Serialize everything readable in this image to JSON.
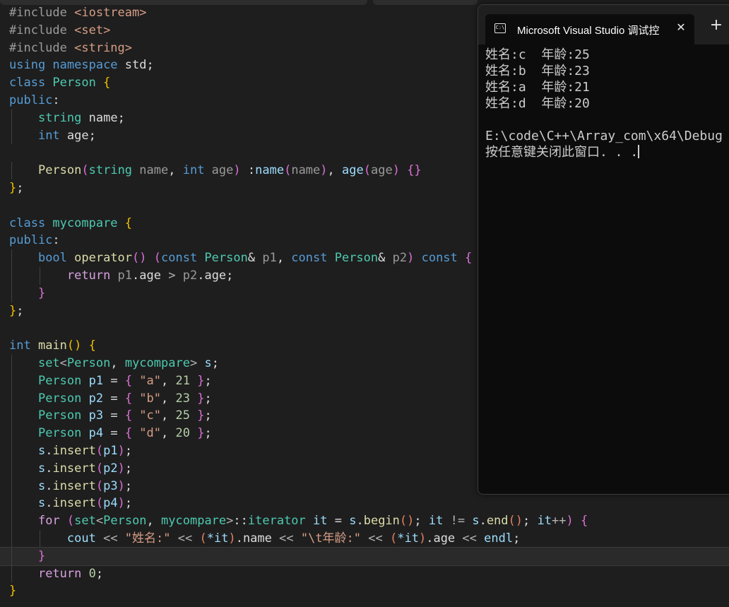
{
  "editor": {
    "lines": [
      [
        [
          "#include ",
          "pp"
        ],
        [
          "<iostream>",
          "inc"
        ]
      ],
      [
        [
          "#include ",
          "pp"
        ],
        [
          "<set>",
          "inc"
        ]
      ],
      [
        [
          "#include ",
          "pp"
        ],
        [
          "<string>",
          "inc"
        ]
      ],
      [
        [
          "using ",
          "kw"
        ],
        [
          "namespace ",
          "kw"
        ],
        [
          "std",
          ""
        ],
        [
          ";",
          ""
        ]
      ],
      [
        [
          "class ",
          "kw"
        ],
        [
          "Person ",
          "cls"
        ],
        [
          "{",
          "b1"
        ]
      ],
      [
        [
          "public",
          "kw"
        ],
        [
          ":",
          ""
        ]
      ],
      [
        [
          "    ",
          ""
        ],
        [
          "string ",
          "cls"
        ],
        [
          "name",
          ""
        ],
        [
          ";",
          ""
        ]
      ],
      [
        [
          "    ",
          ""
        ],
        [
          "int ",
          "kw"
        ],
        [
          "age",
          ""
        ],
        [
          ";",
          ""
        ]
      ],
      [],
      [
        [
          "    ",
          ""
        ],
        [
          "Person",
          "fn"
        ],
        [
          "(",
          "b2"
        ],
        [
          "string ",
          "cls"
        ],
        [
          "name",
          "param"
        ],
        [
          ", ",
          ""
        ],
        [
          "int ",
          "kw"
        ],
        [
          "age",
          "param"
        ],
        [
          ") ",
          "b2"
        ],
        [
          ":",
          ""
        ],
        [
          "name",
          "var"
        ],
        [
          "(",
          "b2"
        ],
        [
          "name",
          "param"
        ],
        [
          ")",
          "b2"
        ],
        [
          ", ",
          ""
        ],
        [
          "age",
          "var"
        ],
        [
          "(",
          "b2"
        ],
        [
          "age",
          "param"
        ],
        [
          ") ",
          "b2"
        ],
        [
          "{}",
          "b2"
        ]
      ],
      [
        [
          "}",
          "b1"
        ],
        [
          ";",
          ""
        ]
      ],
      [],
      [
        [
          "class ",
          "kw"
        ],
        [
          "mycompare ",
          "cls"
        ],
        [
          "{",
          "b1"
        ]
      ],
      [
        [
          "public",
          "kw"
        ],
        [
          ":",
          ""
        ]
      ],
      [
        [
          "    ",
          ""
        ],
        [
          "bool ",
          "kw"
        ],
        [
          "operator",
          "fn"
        ],
        [
          "() ",
          "b2"
        ],
        [
          "(",
          "b2"
        ],
        [
          "const ",
          "kw"
        ],
        [
          "Person",
          "cls"
        ],
        [
          "& ",
          ""
        ],
        [
          "p1",
          "param"
        ],
        [
          ", ",
          ""
        ],
        [
          "const ",
          "kw"
        ],
        [
          "Person",
          "cls"
        ],
        [
          "& ",
          ""
        ],
        [
          "p2",
          "param"
        ],
        [
          ") ",
          "b2"
        ],
        [
          "const ",
          "kw"
        ],
        [
          "{",
          "b2"
        ]
      ],
      [
        [
          "        ",
          ""
        ],
        [
          "return ",
          "ctl"
        ],
        [
          "p1",
          "param"
        ],
        [
          ".",
          ""
        ],
        [
          "age",
          ""
        ],
        [
          " > ",
          "op"
        ],
        [
          "p2",
          "param"
        ],
        [
          ".",
          ""
        ],
        [
          "age",
          ""
        ],
        [
          ";",
          ""
        ]
      ],
      [
        [
          "    ",
          ""
        ],
        [
          "}",
          "b2"
        ]
      ],
      [
        [
          "}",
          "b1"
        ],
        [
          ";",
          ""
        ]
      ],
      [],
      [
        [
          "int ",
          "kw"
        ],
        [
          "main",
          "fn"
        ],
        [
          "() ",
          "b1"
        ],
        [
          "{",
          "b1"
        ]
      ],
      [
        [
          "    ",
          ""
        ],
        [
          "set",
          "cls"
        ],
        [
          "<",
          "op"
        ],
        [
          "Person",
          "cls"
        ],
        [
          ", ",
          ""
        ],
        [
          "mycompare",
          "cls"
        ],
        [
          "> ",
          "op"
        ],
        [
          "s",
          "var"
        ],
        [
          ";",
          ""
        ]
      ],
      [
        [
          "    ",
          ""
        ],
        [
          "Person ",
          "cls"
        ],
        [
          "p1 ",
          "var"
        ],
        [
          "= ",
          ""
        ],
        [
          "{ ",
          "b2"
        ],
        [
          "\"a\"",
          "str"
        ],
        [
          ", ",
          ""
        ],
        [
          "21 ",
          "num"
        ],
        [
          "}",
          "b2"
        ],
        [
          ";",
          ""
        ]
      ],
      [
        [
          "    ",
          ""
        ],
        [
          "Person ",
          "cls"
        ],
        [
          "p2 ",
          "var"
        ],
        [
          "= ",
          ""
        ],
        [
          "{ ",
          "b2"
        ],
        [
          "\"b\"",
          "str"
        ],
        [
          ", ",
          ""
        ],
        [
          "23 ",
          "num"
        ],
        [
          "}",
          "b2"
        ],
        [
          ";",
          ""
        ]
      ],
      [
        [
          "    ",
          ""
        ],
        [
          "Person ",
          "cls"
        ],
        [
          "p3 ",
          "var"
        ],
        [
          "= ",
          ""
        ],
        [
          "{ ",
          "b2"
        ],
        [
          "\"c\"",
          "str"
        ],
        [
          ", ",
          ""
        ],
        [
          "25 ",
          "num"
        ],
        [
          "}",
          "b2"
        ],
        [
          ";",
          ""
        ]
      ],
      [
        [
          "    ",
          ""
        ],
        [
          "Person ",
          "cls"
        ],
        [
          "p4 ",
          "var"
        ],
        [
          "= ",
          ""
        ],
        [
          "{ ",
          "b2"
        ],
        [
          "\"d\"",
          "str"
        ],
        [
          ", ",
          ""
        ],
        [
          "20 ",
          "num"
        ],
        [
          "}",
          "b2"
        ],
        [
          ";",
          ""
        ]
      ],
      [
        [
          "    ",
          ""
        ],
        [
          "s",
          "var"
        ],
        [
          ".",
          ""
        ],
        [
          "insert",
          "fn"
        ],
        [
          "(",
          "b2"
        ],
        [
          "p1",
          "var"
        ],
        [
          ")",
          "b2"
        ],
        [
          ";",
          ""
        ]
      ],
      [
        [
          "    ",
          ""
        ],
        [
          "s",
          "var"
        ],
        [
          ".",
          ""
        ],
        [
          "insert",
          "fn"
        ],
        [
          "(",
          "b2"
        ],
        [
          "p2",
          "var"
        ],
        [
          ")",
          "b2"
        ],
        [
          ";",
          ""
        ]
      ],
      [
        [
          "    ",
          ""
        ],
        [
          "s",
          "var"
        ],
        [
          ".",
          ""
        ],
        [
          "insert",
          "fn"
        ],
        [
          "(",
          "b2"
        ],
        [
          "p3",
          "var"
        ],
        [
          ")",
          "b2"
        ],
        [
          ";",
          ""
        ]
      ],
      [
        [
          "    ",
          ""
        ],
        [
          "s",
          "var"
        ],
        [
          ".",
          ""
        ],
        [
          "insert",
          "fn"
        ],
        [
          "(",
          "b2"
        ],
        [
          "p4",
          "var"
        ],
        [
          ")",
          "b2"
        ],
        [
          ";",
          ""
        ]
      ],
      [
        [
          "    ",
          ""
        ],
        [
          "for ",
          "ctl"
        ],
        [
          "(",
          "b2"
        ],
        [
          "set",
          "cls"
        ],
        [
          "<",
          "op"
        ],
        [
          "Person",
          "cls"
        ],
        [
          ", ",
          ""
        ],
        [
          "mycompare",
          "cls"
        ],
        [
          ">",
          "op"
        ],
        [
          "::",
          ""
        ],
        [
          "iterator ",
          "cls"
        ],
        [
          "it ",
          "var"
        ],
        [
          "= ",
          ""
        ],
        [
          "s",
          "var"
        ],
        [
          ".",
          ""
        ],
        [
          "begin",
          "fn"
        ],
        [
          "()",
          "b3"
        ],
        [
          "; ",
          ""
        ],
        [
          "it ",
          "var"
        ],
        [
          "!= ",
          "op"
        ],
        [
          "s",
          "var"
        ],
        [
          ".",
          ""
        ],
        [
          "end",
          "fn"
        ],
        [
          "()",
          "b3"
        ],
        [
          "; ",
          ""
        ],
        [
          "it",
          "var"
        ],
        [
          "++",
          "op"
        ],
        [
          ") ",
          "b2"
        ],
        [
          "{",
          "b2"
        ]
      ],
      [
        [
          "        ",
          ""
        ],
        [
          "cout ",
          "var"
        ],
        [
          "<< ",
          "op"
        ],
        [
          "\"姓名:\" ",
          "str"
        ],
        [
          "<< ",
          "op"
        ],
        [
          "(",
          "b3"
        ],
        [
          "*it",
          "var"
        ],
        [
          ")",
          "b3"
        ],
        [
          ".",
          ""
        ],
        [
          "name ",
          ""
        ],
        [
          "<< ",
          "op"
        ],
        [
          "\"\\t年龄:\" ",
          "str"
        ],
        [
          "<< ",
          "op"
        ],
        [
          "(",
          "b3"
        ],
        [
          "*it",
          "var"
        ],
        [
          ")",
          "b3"
        ],
        [
          ".",
          ""
        ],
        [
          "age ",
          ""
        ],
        [
          "<< ",
          "op"
        ],
        [
          "endl",
          "var"
        ],
        [
          ";",
          ""
        ]
      ],
      [
        [
          "    ",
          ""
        ],
        [
          "}",
          "b2"
        ]
      ],
      [
        [
          "    ",
          ""
        ],
        [
          "return ",
          "ctl"
        ],
        [
          "0",
          "num"
        ],
        [
          ";",
          ""
        ]
      ],
      [
        [
          "}",
          "b1"
        ]
      ]
    ]
  },
  "console": {
    "tab_title": "Microsoft Visual Studio 调试控",
    "icon_glyph": "C:\\",
    "close_glyph": "✕",
    "new_tab_glyph": "+",
    "output": [
      "姓名:c  年龄:25",
      "姓名:b  年龄:23",
      "姓名:a  年龄:21",
      "姓名:d  年龄:20",
      "",
      "E:\\code\\C++\\Array_com\\x64\\Debug",
      "按任意键关闭此窗口. . ."
    ]
  }
}
